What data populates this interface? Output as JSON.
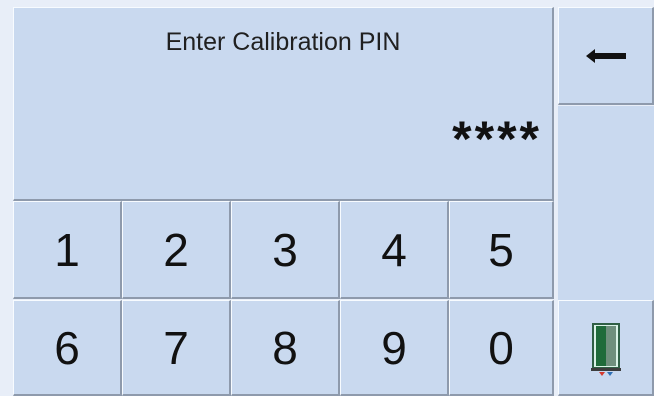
{
  "display": {
    "prompt": "Enter Calibration PIN",
    "entry": "****"
  },
  "keypad": {
    "row1": [
      "1",
      "2",
      "3",
      "4",
      "5"
    ],
    "row2": [
      "6",
      "7",
      "8",
      "9",
      "0"
    ]
  },
  "icons": {
    "backspace": "backspace-arrow-icon",
    "exit": "exit-door-icon"
  }
}
